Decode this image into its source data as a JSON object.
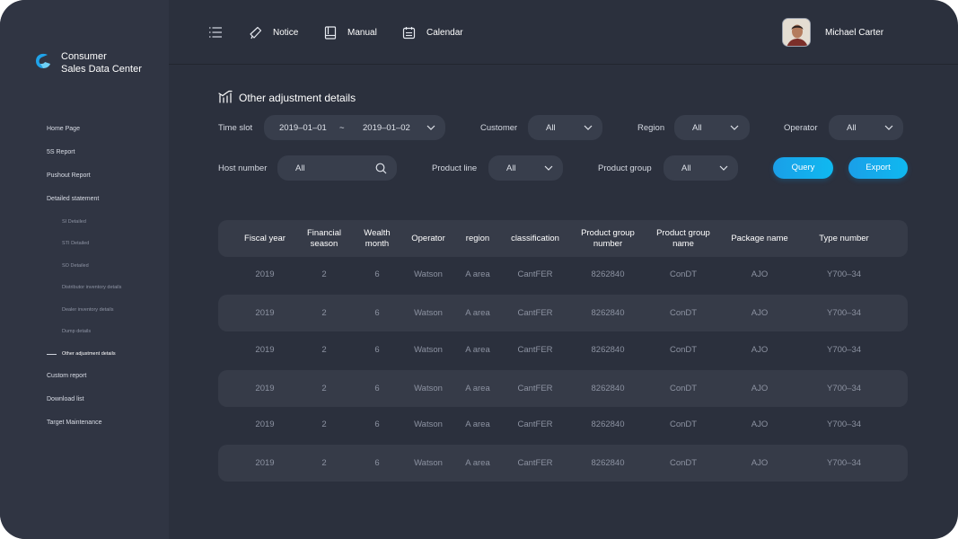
{
  "app": {
    "brand_line1": "Consumer",
    "brand_line2": "Sales Data Center"
  },
  "topbar": {
    "menu_icon": "menu-icon",
    "notice": "Notice",
    "manual": "Manual",
    "calendar": "Calendar",
    "user_name": "Michael Carter"
  },
  "sidebar": {
    "items": [
      "Home Page",
      "5S Report",
      "Pushout Report",
      "Detailed statement",
      "Custom report",
      "Download list",
      "Target Maintenance"
    ],
    "sub_items": [
      "SI Detailed",
      "STI Detailed",
      "SO Detailed",
      "Distributor inventory details",
      "Dealer inventory details",
      "Dump details",
      "Other adjustment details"
    ]
  },
  "page": {
    "title": "Other adjustment details"
  },
  "filters": {
    "time_slot_label": "Time slot",
    "date_from": "2019–01–01",
    "date_sep": "~",
    "date_to": "2019–01–02",
    "customer_label": "Customer",
    "customer_value": "All",
    "region_label": "Region",
    "region_value": "All",
    "operator_label": "Operator",
    "operator_value": "All",
    "host_label": "Host number",
    "host_value": "All",
    "product_line_label": "Product line",
    "product_line_value": "All",
    "product_group_label": "Product group",
    "product_group_value": "All",
    "query_label": "Query",
    "export_label": "Export"
  },
  "table": {
    "headers": [
      [
        "Fiscal year"
      ],
      [
        "Financial",
        "season"
      ],
      [
        "Wealth",
        "month"
      ],
      [
        "Operator"
      ],
      [
        "region"
      ],
      [
        "classification"
      ],
      [
        "Product group",
        "number"
      ],
      [
        "Product group",
        "name"
      ],
      [
        "Package name"
      ],
      [
        "Type number"
      ]
    ],
    "rows": [
      [
        "2019",
        "2",
        "6",
        "Watson",
        "A area",
        "CantFER",
        "8262840",
        "ConDT",
        "AJO",
        "Y700–34"
      ],
      [
        "2019",
        "2",
        "6",
        "Watson",
        "A area",
        "CantFER",
        "8262840",
        "ConDT",
        "AJO",
        "Y700–34"
      ],
      [
        "2019",
        "2",
        "6",
        "Watson",
        "A area",
        "CantFER",
        "8262840",
        "ConDT",
        "AJO",
        "Y700–34"
      ],
      [
        "2019",
        "2",
        "6",
        "Watson",
        "A area",
        "CantFER",
        "8262840",
        "ConDT",
        "AJO",
        "Y700–34"
      ],
      [
        "2019",
        "2",
        "6",
        "Watson",
        "A area",
        "CantFER",
        "8262840",
        "ConDT",
        "AJO",
        "Y700–34"
      ],
      [
        "2019",
        "2",
        "6",
        "Watson",
        "A area",
        "CantFER",
        "8262840",
        "ConDT",
        "AJO",
        "Y700–34"
      ]
    ]
  },
  "colors": {
    "accent": "#0fb9f0",
    "background": "#2b303d",
    "sidebar": "#303543",
    "row_alt": "#363b48"
  }
}
